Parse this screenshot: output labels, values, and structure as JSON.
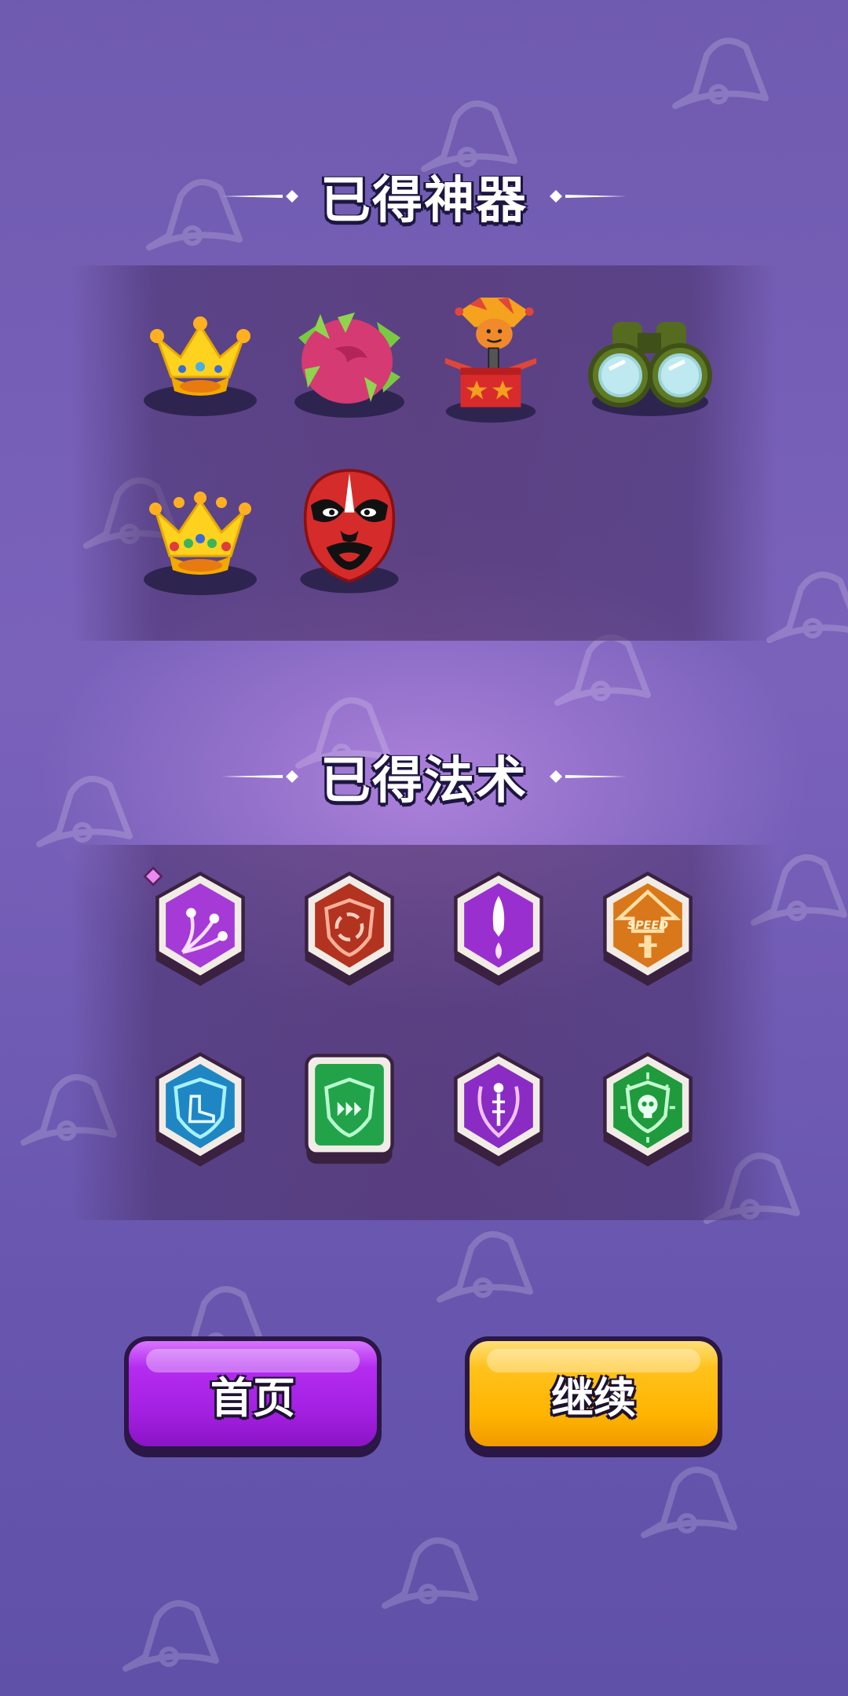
{
  "artifacts_section": {
    "title": "已得神器",
    "items": [
      {
        "icon": "gold-crown-icon"
      },
      {
        "icon": "dragon-fruit-icon"
      },
      {
        "icon": "jack-in-the-box-icon"
      },
      {
        "icon": "binoculars-icon"
      },
      {
        "icon": "jeweled-crown-icon"
      },
      {
        "icon": "opera-mask-icon"
      }
    ]
  },
  "spells_section": {
    "title": "已得法术",
    "items": [
      {
        "icon": "split-shot-spell-icon",
        "color": "#a53ad6",
        "badge": true
      },
      {
        "icon": "rotation-shield-spell-icon",
        "color": "#b2331f"
      },
      {
        "icon": "piercing-shot-spell-icon",
        "color": "#9a2fd0"
      },
      {
        "icon": "speed-up-spell-icon",
        "color": "#d9771b",
        "text": "SPEED"
      },
      {
        "icon": "boot-shield-spell-icon",
        "color": "#1f86c4"
      },
      {
        "icon": "dash-shield-spell-icon",
        "color": "#22a34a"
      },
      {
        "icon": "bone-shield-spell-icon",
        "color": "#8a2bc4"
      },
      {
        "icon": "poison-skull-spell-icon",
        "color": "#1f9a3c"
      }
    ]
  },
  "buttons": {
    "home_label": "首页",
    "continue_label": "继续"
  },
  "colors": {
    "background": "#6f5bb0",
    "home_button": "#a21fe0",
    "continue_button": "#ffb400"
  }
}
